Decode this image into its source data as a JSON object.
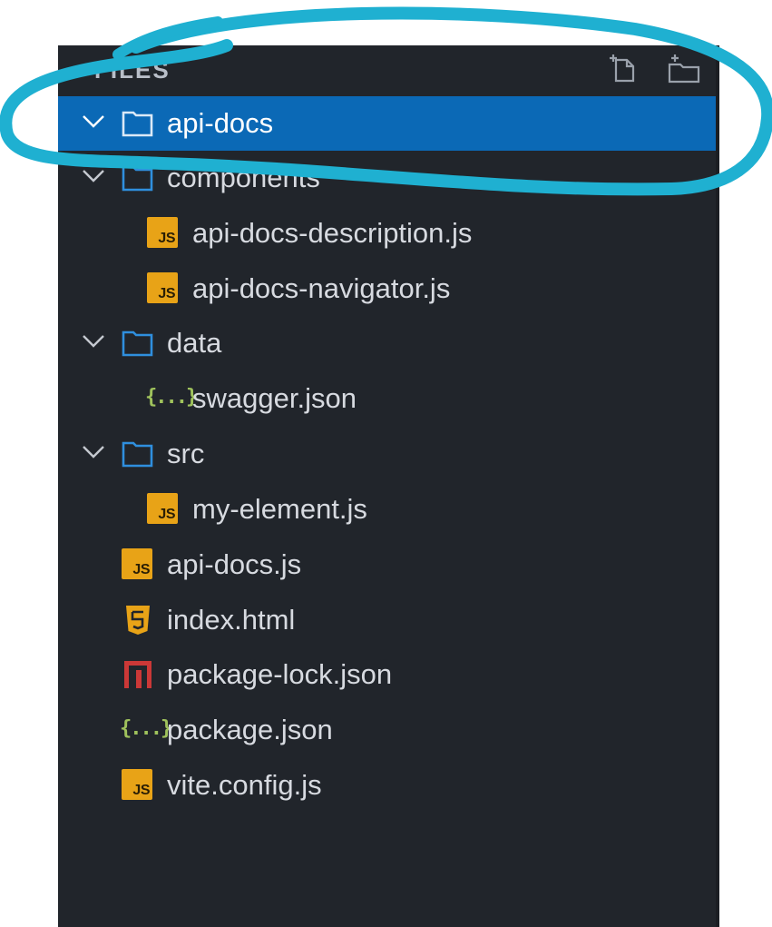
{
  "panel": {
    "title": "FILES",
    "actions": [
      {
        "name": "new-file",
        "icon": "new-file-icon"
      },
      {
        "name": "new-folder",
        "icon": "new-folder-icon"
      }
    ]
  },
  "tree": {
    "root": {
      "label": "api-docs",
      "type": "folder",
      "expanded": true,
      "selected": true
    },
    "folder_components": {
      "label": "components",
      "type": "folder",
      "expanded": true
    },
    "file_api_docs_description": {
      "label": "api-docs-description.js",
      "type": "js"
    },
    "file_api_docs_navigator": {
      "label": "api-docs-navigator.js",
      "type": "js"
    },
    "folder_data": {
      "label": "data",
      "type": "folder",
      "expanded": true
    },
    "file_swagger": {
      "label": "swagger.json",
      "type": "json"
    },
    "folder_src": {
      "label": "src",
      "type": "folder",
      "expanded": true
    },
    "file_my_element": {
      "label": "my-element.js",
      "type": "js"
    },
    "file_api_docs_js": {
      "label": "api-docs.js",
      "type": "js"
    },
    "file_index_html": {
      "label": "index.html",
      "type": "html"
    },
    "file_package_lock": {
      "label": "package-lock.json",
      "type": "npm"
    },
    "file_package_json": {
      "label": "package.json",
      "type": "json"
    },
    "file_vite_config": {
      "label": "vite.config.js",
      "type": "js"
    }
  },
  "icon_glyphs": {
    "js": "JS",
    "json": "{...}"
  },
  "colors": {
    "panel_bg": "#21252b",
    "selection": "#0b69b6",
    "folder": "#2f8fde",
    "js": "#e8a317",
    "html": "#e8a317",
    "npm": "#cb3837",
    "json": "#9fc25c",
    "annotation": "#1fb0d1"
  }
}
